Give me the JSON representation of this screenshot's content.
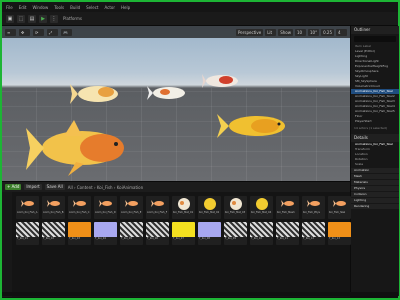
{
  "menu": [
    "File",
    "Edit",
    "Window",
    "Tools",
    "Build",
    "Select",
    "Actor",
    "Help"
  ],
  "toolbar": {
    "platforms_label": "Platforms",
    "play_icon": "play-icon"
  },
  "viewport": {
    "perspective_label": "Perspective",
    "lit_label": "Lit",
    "show_label": "Show",
    "speed_label": "4",
    "grid_label": "10",
    "angle_label": "10°",
    "scale_label": "0.25"
  },
  "outliner": {
    "title": "Outliner",
    "header": "Item Label",
    "rows": [
      {
        "label": "Level (Editor)",
        "selected": false
      },
      {
        "label": "Lighting",
        "selected": false
      },
      {
        "label": "DirectionalLight",
        "selected": false
      },
      {
        "label": "ExponentialHeightFog",
        "selected": false
      },
      {
        "label": "SkyAtmosphere",
        "selected": false
      },
      {
        "label": "SkyLight",
        "selected": false
      },
      {
        "label": "SM_SkySphere",
        "selected": false
      },
      {
        "label": "VolumetricCloud",
        "selected": false
      },
      {
        "label": "Animations_Koi_Fish_Skel",
        "selected": true
      },
      {
        "label": "Animations_Koi_Fish_Skel2",
        "selected": false
      },
      {
        "label": "Animations_Koi_Fish_Skel3",
        "selected": false
      },
      {
        "label": "Animations_Koi_Fish_Skel4",
        "selected": false
      },
      {
        "label": "Animations_Koi_Fish_Skel5",
        "selected": false
      },
      {
        "label": "Floor",
        "selected": false
      },
      {
        "label": "PlayerStart",
        "selected": false
      }
    ],
    "count": "14 actors (1 selected)"
  },
  "details": {
    "title": "Details",
    "selected_actor": "Animations_Koi_Fish_Skel",
    "rows": [
      "Transform",
      "Location",
      "Rotation",
      "Scale"
    ],
    "sections": [
      "Animation",
      "Mesh",
      "Materials",
      "Physics",
      "Collision",
      "Lighting",
      "Rendering"
    ]
  },
  "content_browser": {
    "add_label": "+ Add",
    "import_label": "Import",
    "save_label": "Save All",
    "breadcrumb": [
      "All",
      "Content",
      "Koi_Fish",
      "KoiAnimation"
    ],
    "search_placeholder": "Search KoiAnimation",
    "assets": [
      {
        "label": "Anim_Koi_Fish_A",
        "kind": "fish"
      },
      {
        "label": "Anim_Koi_Fish_B",
        "kind": "fish"
      },
      {
        "label": "Anim_Koi_Fish_C",
        "kind": "fish"
      },
      {
        "label": "Anim_Koi_Fish_D",
        "kind": "fish"
      },
      {
        "label": "Anim_Koi_Fish_E",
        "kind": "fish"
      },
      {
        "label": "Anim_Koi_Fish_F",
        "kind": "fish"
      },
      {
        "label": "Koi_Fish_Mat_01",
        "kind": "sphere-white"
      },
      {
        "label": "Koi_Fish_Mat_02",
        "kind": "sphere-yellow"
      },
      {
        "label": "Koi_Fish_Mat_03",
        "kind": "sphere-white"
      },
      {
        "label": "Koi_Fish_Mat_04",
        "kind": "sphere-yellow"
      },
      {
        "label": "Koi_Fish_Mesh",
        "kind": "fish"
      },
      {
        "label": "Koi_Fish_Phys",
        "kind": "fish"
      },
      {
        "label": "Koi_Fish_Skel",
        "kind": "fish"
      },
      {
        "label": "T_Koi_01",
        "kind": "tex-bw"
      },
      {
        "label": "T_Koi_02",
        "kind": "tex-bw"
      },
      {
        "label": "T_Koi_03",
        "kind": "tex-orange"
      },
      {
        "label": "T_Koi_04",
        "kind": "tex-lilac"
      },
      {
        "label": "T_Koi_05",
        "kind": "tex-bw"
      },
      {
        "label": "T_Koi_06",
        "kind": "tex-bw"
      },
      {
        "label": "T_Koi_07",
        "kind": "tex-yellow"
      },
      {
        "label": "T_Koi_08",
        "kind": "tex-lilac"
      },
      {
        "label": "T_Koi_09",
        "kind": "tex-bw"
      },
      {
        "label": "T_Koi_10",
        "kind": "tex-bw"
      },
      {
        "label": "T_Koi_11",
        "kind": "tex-bw"
      },
      {
        "label": "T_Koi_12",
        "kind": "tex-bw"
      },
      {
        "label": "T_Koi_13",
        "kind": "tex-orange"
      }
    ]
  }
}
